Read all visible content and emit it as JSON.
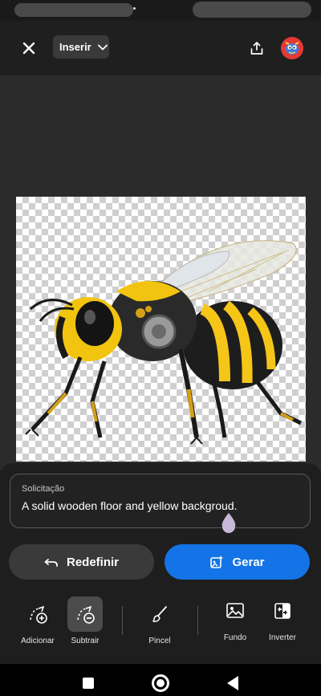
{
  "top_bar": {
    "close_icon": "close-icon",
    "insert_dropdown_label": "Inserir",
    "share_icon": "share-icon"
  },
  "canvas": {
    "subject": "robotic yellow-black bee on transparent background"
  },
  "prompt": {
    "label": "Solicitação",
    "value": "A solid wooden floor and yellow backgroud."
  },
  "actions": {
    "reset_label": "Redefinir",
    "generate_label": "Gerar"
  },
  "tools": [
    {
      "label": "Adicionar",
      "icon": "add-selection-icon",
      "active": false
    },
    {
      "label": "Subtrair",
      "icon": "subtract-selection-icon",
      "active": true
    },
    {
      "label": "Pincel",
      "icon": "brush-icon",
      "active": false
    },
    {
      "label": "Fundo",
      "icon": "background-icon",
      "active": false
    },
    {
      "label": "Inverter",
      "icon": "invert-icon",
      "active": false
    }
  ],
  "colors": {
    "accent": "#1473e6",
    "panel": "#1e1e1e",
    "button_secondary": "#3a3a3a"
  }
}
